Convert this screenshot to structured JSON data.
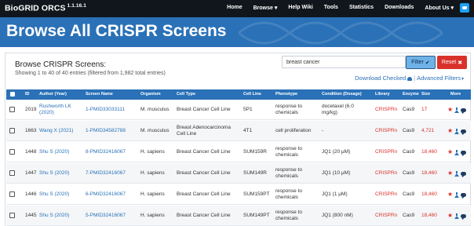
{
  "brand": {
    "name": "BioGRID ORCS",
    "version": "1.1.16.1"
  },
  "nav": [
    {
      "label": "Home"
    },
    {
      "label": "Browse ▾"
    },
    {
      "label": "Help Wiki"
    },
    {
      "label": "Tools"
    },
    {
      "label": "Statistics"
    },
    {
      "label": "Downloads"
    },
    {
      "label": "About Us ▾"
    }
  ],
  "banner": {
    "title": "Browse All CRISPR Screens"
  },
  "panel": {
    "title": "Browse CRISPR Screens:",
    "subtitle": "Showing 1 to 40 of 40 entries (filtered from 1,982 total entries)",
    "search_value": "breast cancer",
    "filter_label": "Filter",
    "reset_label": "Reset",
    "download_label": "Download Checked",
    "advanced_label": "Advanced Filters"
  },
  "columns": [
    "ID",
    "Author (Year)",
    "Screen Name",
    "Organism",
    "Cell Type",
    "Cell Line",
    "Phenotype",
    "Condition (Dosage)",
    "Library",
    "Enzyme",
    "Size",
    "More"
  ],
  "rows": [
    {
      "year": "2019",
      "author": [
        "Rushworth LK",
        "(2020)"
      ],
      "screen": "1-PMID33033111",
      "organism": "M. musculus",
      "cell_type": [
        "Breast Cancer Cell Line"
      ],
      "cell_line": "5P1",
      "phenotype": [
        "response to",
        "chemicals"
      ],
      "condition": [
        "docetaxel (6.0",
        "mg/kg)"
      ],
      "library": "CRISPRn",
      "enzyme": "Cas9",
      "size": "17"
    },
    {
      "year": "1663",
      "author": [
        "Wang X (2021)"
      ],
      "screen": "1-PMID34582788",
      "organism": "M. musculus",
      "cell_type": [
        "Breast Adenocarcinoma",
        "Cell Line"
      ],
      "cell_line": "4T1",
      "phenotype": [
        "cell proliferation"
      ],
      "condition": [
        "-"
      ],
      "library": "CRISPRn",
      "enzyme": "Cas9",
      "size": "4,721"
    },
    {
      "year": "1448",
      "author": [
        "Shu S (2020)"
      ],
      "screen": "8-PMID32416067",
      "organism": "H. sapiens",
      "cell_type": [
        "Breast Cancer Cell Line"
      ],
      "cell_line": "SUM159R",
      "phenotype": [
        "response to",
        "chemicals"
      ],
      "condition": [
        "JQ1 (20 μM)"
      ],
      "library": "CRISPRn",
      "enzyme": "Cas9",
      "size": "18,460"
    },
    {
      "year": "1447",
      "author": [
        "Shu S (2020)"
      ],
      "screen": "7-PMID32416067",
      "organism": "H. sapiens",
      "cell_type": [
        "Breast Cancer Cell Line"
      ],
      "cell_line": "SUM149R",
      "phenotype": [
        "response to",
        "chemicals"
      ],
      "condition": [
        "JQ1 (10 μM)"
      ],
      "library": "CRISPRn",
      "enzyme": "Cas9",
      "size": "18,460"
    },
    {
      "year": "1446",
      "author": [
        "Shu S (2020)"
      ],
      "screen": "6-PMID32416067",
      "organism": "H. sapiens",
      "cell_type": [
        "Breast Cancer Cell Line"
      ],
      "cell_line": "SUM159PT",
      "phenotype": [
        "response to",
        "chemicals"
      ],
      "condition": [
        "JQ1 (1 μM)"
      ],
      "library": "CRISPRn",
      "enzyme": "Cas9",
      "size": "18,460"
    },
    {
      "year": "1445",
      "author": [
        "Shu S (2020)"
      ],
      "screen": "5-PMID32416067",
      "organism": "H. sapiens",
      "cell_type": [
        "Breast Cancer Cell Line"
      ],
      "cell_line": "SUM149PT",
      "phenotype": [
        "response to",
        "chemicals"
      ],
      "condition": [
        "JQ1 (800 nM)"
      ],
      "library": "CRISPRn",
      "enzyme": "Cas9",
      "size": "18,460"
    }
  ],
  "colors": {
    "navbar": "#10161c",
    "banner": "#2a71b7",
    "accent_red": "#d9322b",
    "filter": "#6fb2e8"
  }
}
